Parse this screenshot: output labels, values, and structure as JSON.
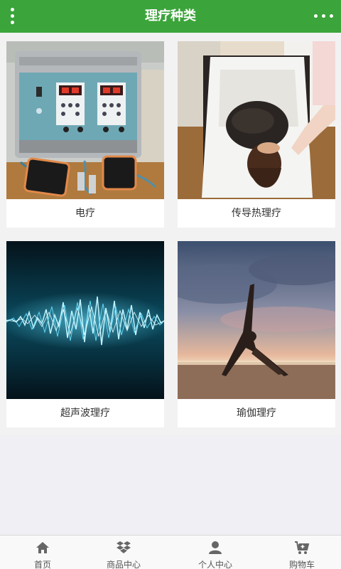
{
  "header": {
    "title": "理疗种类"
  },
  "categories": [
    {
      "label": "电疗",
      "image": "electrotherapy-device-photo"
    },
    {
      "label": "传导热理疗",
      "image": "heat-therapy-mud-wrap-photo"
    },
    {
      "label": "超声波理疗",
      "image": "ultrasound-wave-photo"
    },
    {
      "label": "瑜伽理疗",
      "image": "yoga-beach-sunset-photo"
    }
  ],
  "tabbar": {
    "items": [
      {
        "label": "首页",
        "icon": "home-icon"
      },
      {
        "label": "商品中心",
        "icon": "dropbox-icon"
      },
      {
        "label": "个人中心",
        "icon": "user-icon"
      },
      {
        "label": "购物车",
        "icon": "cart-icon"
      }
    ]
  },
  "colors": {
    "brand": "#3ba43a",
    "background": "#efeff4"
  }
}
